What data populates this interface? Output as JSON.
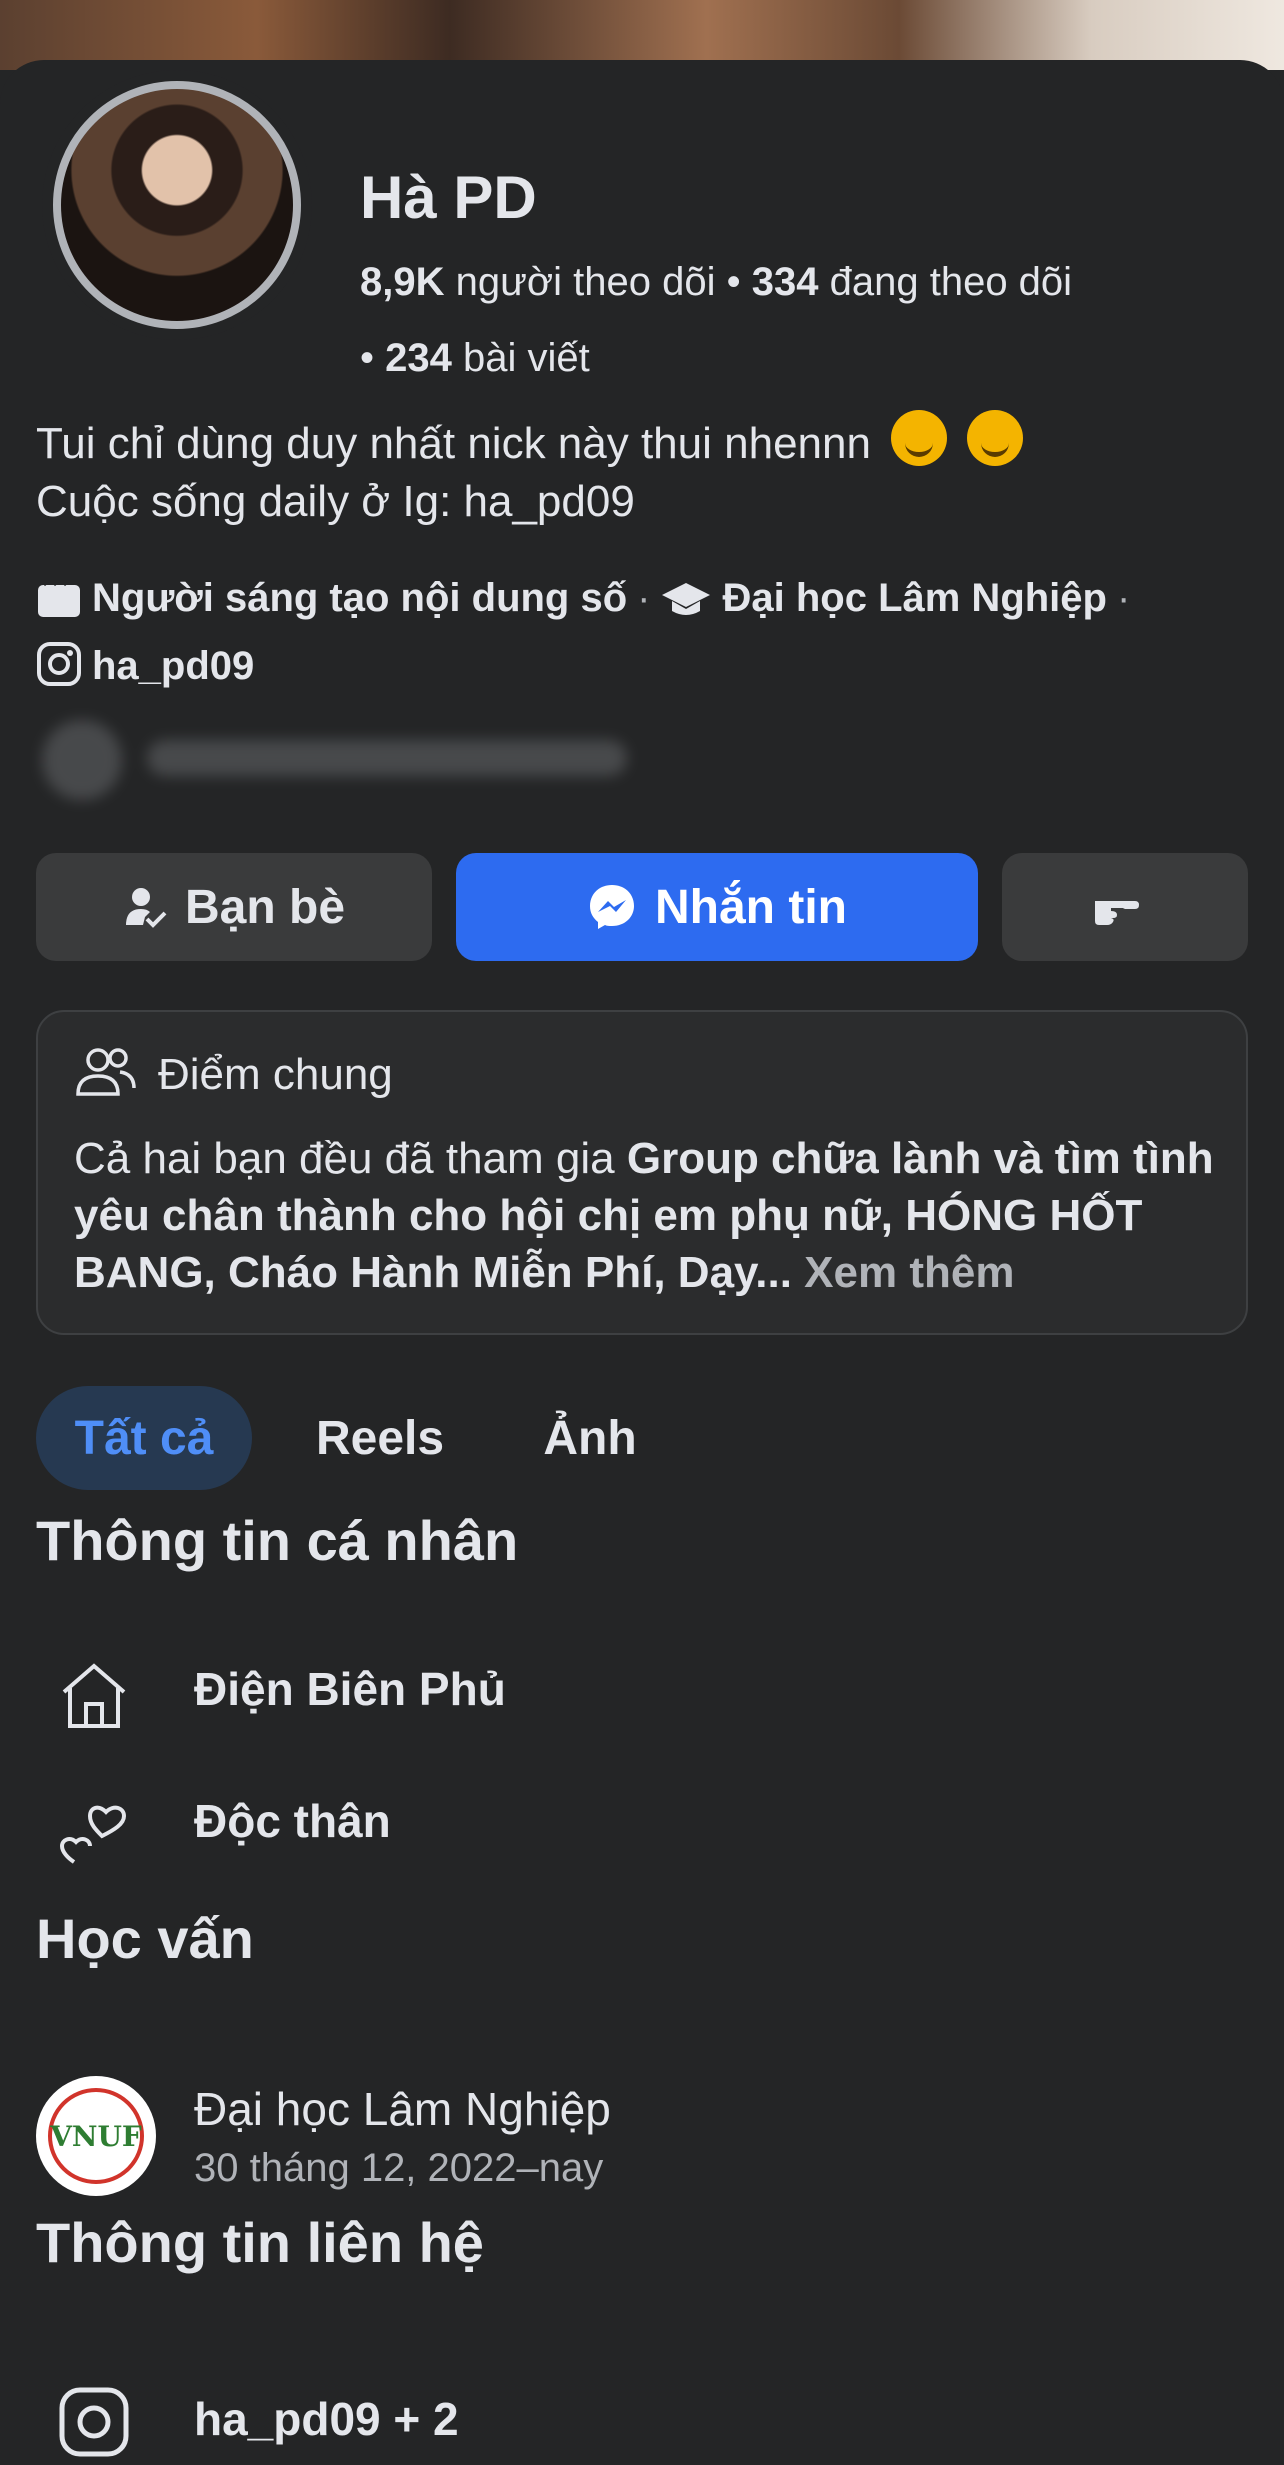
{
  "profile": {
    "name": "Hà PD",
    "followers_value": "8,9K",
    "followers_label": "người theo dõi",
    "following_value": "334",
    "following_label": "đang theo dõi",
    "posts_value": "234",
    "posts_label": "bài viết",
    "separator": "•"
  },
  "bio": {
    "line1": "Tui chỉ dùng duy nhất nick này thui nhennn",
    "line2": "Cuộc sống daily ở Ig: ha_pd09"
  },
  "meta": {
    "creator": "Người sáng tạo nội dung số",
    "school": "Đại học Lâm Nghiệp",
    "instagram": "ha_pd09",
    "dot": "·"
  },
  "actions": {
    "friends": "Bạn bè",
    "message": "Nhắn tin",
    "message_color": "#2d6bf0"
  },
  "common": {
    "title": "Điểm chung",
    "prefix": "Cả hai bạn đều đã tham gia ",
    "groups": "Group chữa lành và tìm tình yêu chân thành cho hội chị em phụ nữ, HÓNG HỐT BANG, Cháo Hành Miễn Phí, Dạy...",
    "see_more": "Xem thêm"
  },
  "tabs": {
    "all": "Tất cả",
    "reels": "Reels",
    "photos": "Ảnh",
    "active_color": "#4f8ef7"
  },
  "personal": {
    "title": "Thông tin cá nhân",
    "hometown": "Điện Biên Phủ",
    "relationship": "Độc thân"
  },
  "education": {
    "title": "Học vấn",
    "school": "Đại học Lâm Nghiệp",
    "date": "30 tháng 12, 2022–nay",
    "logo_text": "VNUF"
  },
  "contact": {
    "title": "Thông tin liên hệ",
    "instagram": "ha_pd09 + 2"
  }
}
